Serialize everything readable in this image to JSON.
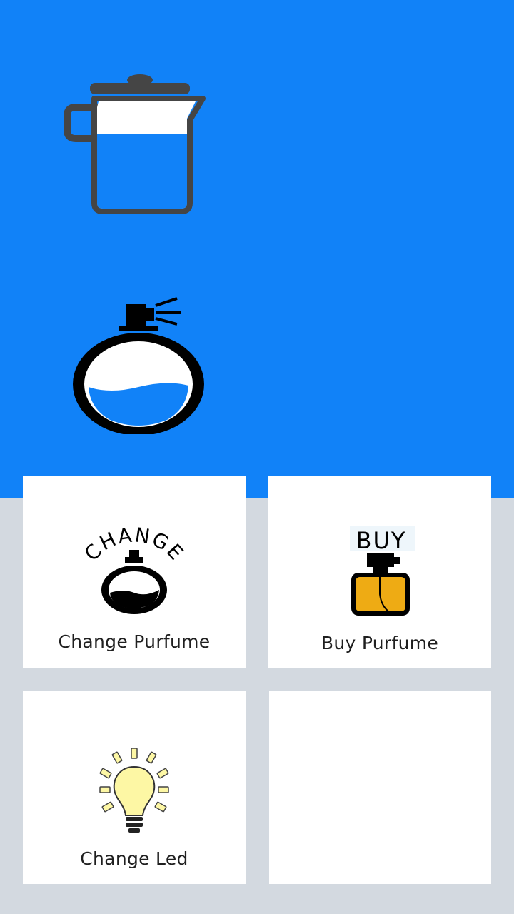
{
  "status": {
    "water_icon": "water-jug-icon",
    "perfume_icon": "perfume-bottle-icon",
    "water_level_percent": 75,
    "perfume_level_percent": 45
  },
  "actions": [
    {
      "label": "Change Purfume",
      "icon": "change-perfume-icon",
      "icon_text": "CHANGE"
    },
    {
      "label": "Buy Purfume",
      "icon": "buy-perfume-icon",
      "icon_text": "BUY"
    },
    {
      "label": "Change Led",
      "icon": "lightbulb-icon"
    }
  ],
  "colors": {
    "header_blue": "#1182f8",
    "background_gray": "#d3d9e0",
    "card_white": "#ffffff",
    "water_blue": "#1182f8",
    "jug_gray": "#454545",
    "perfume_gold": "#eeab14",
    "bulb_yellow": "#fdf7a4"
  }
}
